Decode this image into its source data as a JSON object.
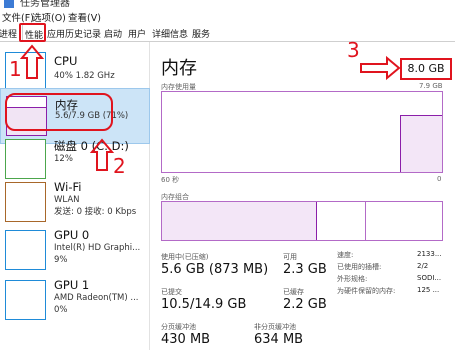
{
  "window": {
    "title": "任务管理器"
  },
  "menu": [
    "文件(F)",
    "选项(O)",
    "查看(V)"
  ],
  "tabs": [
    "进程",
    "性能",
    "应用历史记录",
    "启动",
    "用户",
    "详细信息",
    "服务"
  ],
  "active_tab": "性能",
  "resources": [
    {
      "name": "CPU",
      "detail1": "40% 1.82 GHz",
      "detail2": "",
      "color": "#1f8bd8",
      "selected": false
    },
    {
      "name": "内存",
      "detail1": "5.6/7.9 GB (71%)",
      "detail2": "",
      "color": "#8b1fa9",
      "selected": true
    },
    {
      "name": "磁盘 0 (C: D:)",
      "detail1": "12%",
      "detail2": "",
      "color": "#4ca64c",
      "selected": false
    },
    {
      "name": "Wi-Fi",
      "detail1": "WLAN",
      "detail2": "发送: 0 接收: 0 Kbps",
      "color": "#a8672a",
      "selected": false
    },
    {
      "name": "GPU 0",
      "detail1": "Intel(R) HD Graphi...",
      "detail2": "9%",
      "color": "#1f8bd8",
      "selected": false
    },
    {
      "name": "GPU 1",
      "detail1": "AMD Radeon(TM) ...",
      "detail2": "0%",
      "color": "#1f8bd8",
      "selected": false
    }
  ],
  "memory": {
    "title": "内存",
    "total": "8.0 GB",
    "usage_label": "内存使用量",
    "usage_max": "7.9 GB",
    "time_left": "60 秒",
    "time_right": "0",
    "composition_label": "内存组合",
    "usage_fraction": 0.71,
    "stats": {
      "in_use_label": "使用中(已压缩)",
      "in_use_value": "5.6 GB (873 MB)",
      "available_label": "可用",
      "available_value": "2.3 GB",
      "committed_label": "已提交",
      "committed_value": "10.5/14.9 GB",
      "cached_label": "已缓存",
      "cached_value": "2.2 GB",
      "paged_label": "分页缓冲池",
      "paged_value": "430 MB",
      "nonpaged_label": "非分页缓冲池",
      "nonpaged_value": "634 MB"
    },
    "details": [
      {
        "label": "速度:",
        "value": "2133..."
      },
      {
        "label": "已使用的插槽:",
        "value": "2/2"
      },
      {
        "label": "外形规格:",
        "value": "SODI..."
      },
      {
        "label": "为硬件保留的内存:",
        "value": "125 ..."
      }
    ]
  },
  "annotations": {
    "n1": "1",
    "n2": "2",
    "n3": "3"
  },
  "colors": {
    "annotation": "#e0141e",
    "memory": "#8b1fa9",
    "selected_bg": "#cce4f7"
  }
}
